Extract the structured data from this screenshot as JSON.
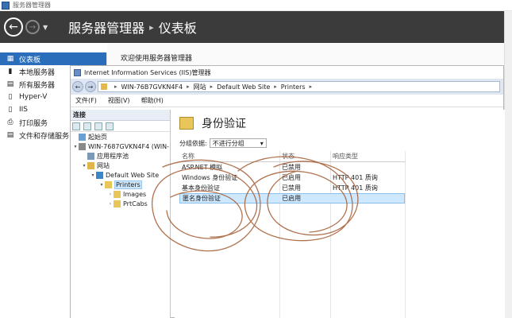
{
  "server_manager": {
    "window_title": "服务器管理器",
    "breadcrumb": [
      "服务器管理器",
      "仪表板"
    ],
    "welcome": "欢迎使用服务器管理器",
    "sidebar": [
      {
        "label": "仪表板",
        "icon": "dashboard-icon",
        "glyph": "▦",
        "active": true
      },
      {
        "label": "本地服务器",
        "icon": "server-icon",
        "glyph": "▮"
      },
      {
        "label": "所有服务器",
        "icon": "servers-icon",
        "glyph": "▤"
      },
      {
        "label": "Hyper-V",
        "icon": "hyperv-icon",
        "glyph": "▯"
      },
      {
        "label": "IIS",
        "icon": "iis-icon",
        "glyph": "▯"
      },
      {
        "label": "打印服务",
        "icon": "printer-icon",
        "glyph": "⎙"
      },
      {
        "label": "文件和存储服务",
        "icon": "storage-icon",
        "glyph": "▤"
      }
    ]
  },
  "iis": {
    "title": "Internet Information Services (IIS)管理器",
    "address": [
      "WIN-76B7GVKN4F4",
      "网站",
      "Default Web Site",
      "Printers"
    ],
    "menu": [
      "文件(F)",
      "视图(V)",
      "帮助(H)"
    ],
    "connections_label": "连接",
    "tree": [
      {
        "label": "起始页",
        "indent": 0,
        "exp": "",
        "icon": "home-icon",
        "color": "#6aa0d8"
      },
      {
        "label": "WIN-7687GVKN4F4 (WIN-",
        "indent": 0,
        "exp": "▾",
        "icon": "server-icon",
        "color": "#8a8a8a"
      },
      {
        "label": "应用程序池",
        "indent": 1,
        "exp": "",
        "icon": "pool-icon",
        "color": "#7a9ab8"
      },
      {
        "label": "网站",
        "indent": 1,
        "exp": "▾",
        "icon": "sites-icon",
        "color": "#e0b64c"
      },
      {
        "label": "Default Web Site",
        "indent": 2,
        "exp": "▾",
        "icon": "globe-icon",
        "color": "#3a86c8"
      },
      {
        "label": "Printers",
        "indent": 3,
        "exp": "▾",
        "icon": "folder-icon",
        "color": "#e8c65a",
        "selected": true
      },
      {
        "label": "Images",
        "indent": 4,
        "exp": "›",
        "icon": "folder-icon",
        "color": "#e8c65a"
      },
      {
        "label": "PrtCabs",
        "indent": 4,
        "exp": "›",
        "icon": "folder-icon",
        "color": "#e8c65a"
      }
    ],
    "main": {
      "title": "身份验证",
      "group_label": "分组依据:",
      "group_value": "不进行分组",
      "columns": [
        "名称",
        "状态",
        "响应类型"
      ],
      "rows": [
        {
          "name": "ASP.NET 模拟",
          "status": "已禁用",
          "response": ""
        },
        {
          "name": "Windows 身份验证",
          "status": "已启用",
          "response": "HTTP 401 质询"
        },
        {
          "name": "基本身份验证",
          "status": "已禁用",
          "response": "HTTP 401 质询"
        },
        {
          "name": "匿名身份验证",
          "status": "已启用",
          "response": "",
          "selected": true
        }
      ]
    }
  }
}
